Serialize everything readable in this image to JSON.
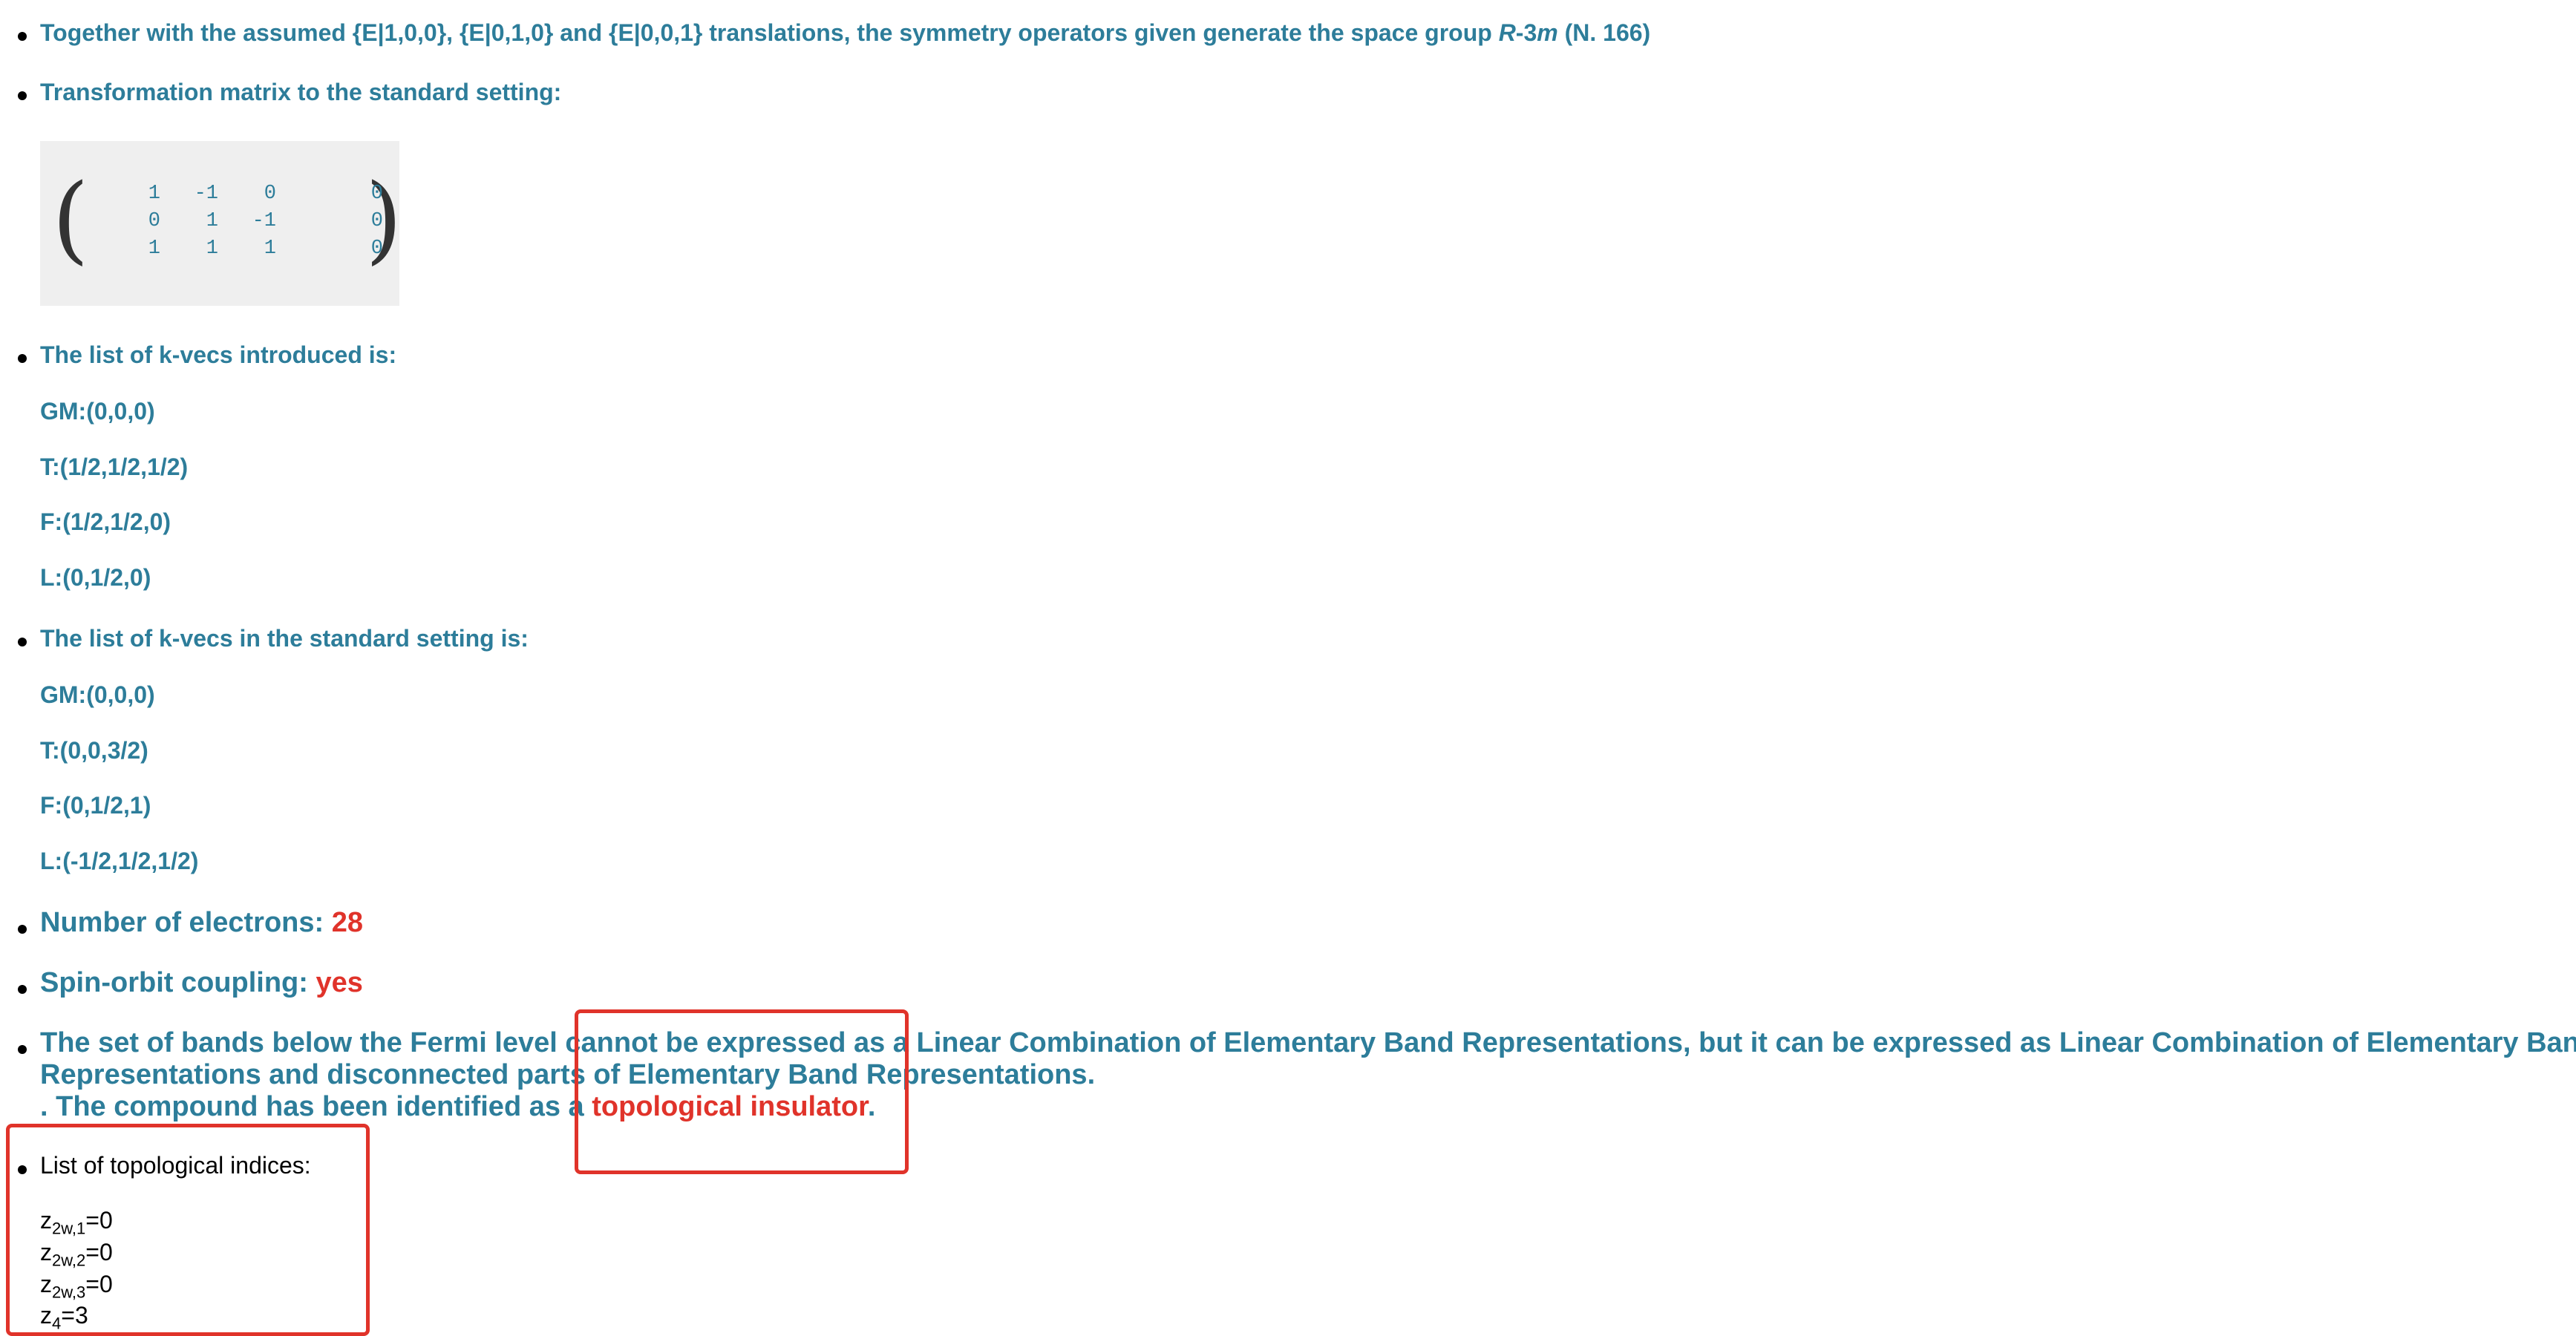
{
  "symmetry_note": {
    "prefix": "Together with the assumed {E|1,0,0}, {E|0,1,0} and {E|0,0,1} translations, the symmetry operators given generate the space group ",
    "group_symbol_italic": "R",
    "group_symbol_mid": "-3",
    "group_symbol_italic2": "m",
    "suffix": " (N. 166)"
  },
  "transformation_label": "Transformation matrix to the standard setting:",
  "matrix": [
    [
      "1",
      "-1",
      "0",
      "0"
    ],
    [
      "0",
      "1",
      "-1",
      "0"
    ],
    [
      "1",
      "1",
      "1",
      "0"
    ]
  ],
  "paren_left": "(",
  "paren_right": ")",
  "kvecs_introduced_label": "The list of k-vecs introduced is:",
  "kvecs_introduced": [
    "GM:(0,0,0)",
    "T:(1/2,1/2,1/2)",
    "F:(1/2,1/2,0)",
    "L:(0,1/2,0)"
  ],
  "kvecs_standard_label": "The list of k-vecs in the standard setting is:",
  "kvecs_standard": [
    "GM:(0,0,0)",
    "T:(0,0,3/2)",
    "F:(0,1/2,1)",
    "L:(-1/2,1/2,1/2)"
  ],
  "electrons": {
    "label": "Number of electrons: ",
    "value": "28"
  },
  "soc": {
    "label": "Spin-orbit coupling: ",
    "value": "yes"
  },
  "bands": {
    "line1": "The set of bands below the Fermi level cannot be expressed as a Linear Combination of Elementary Band Representations, but it can be expressed as Linear Combination of Elementary Band",
    "line2": "Representations and disconnected parts of Elementary Band Representations.",
    "line3_prefix": ". The compound has been identified as a ",
    "line3_highlight": "topological insulator",
    "line3_suffix": "."
  },
  "indices_label": "List of topological indices:",
  "indices": [
    {
      "base": "z",
      "sub": "2w,1",
      "value": "=0"
    },
    {
      "base": "z",
      "sub": "2w,2",
      "value": "=0"
    },
    {
      "base": "z",
      "sub": "2w,3",
      "value": "=0"
    },
    {
      "base": "z",
      "sub": "4",
      "value": "=3"
    }
  ],
  "colors": {
    "text": "#2d7d9a",
    "highlight": "#e0332a",
    "matrix_bg": "#efefef"
  }
}
